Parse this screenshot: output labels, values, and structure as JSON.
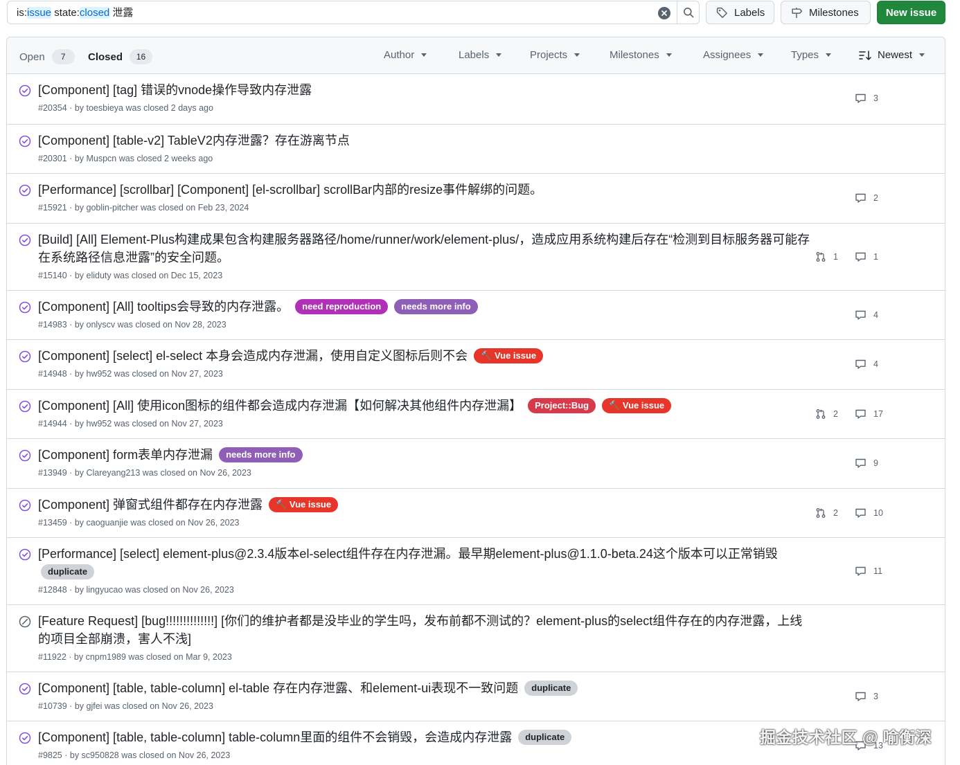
{
  "search": {
    "tokens": [
      {
        "text": "is:",
        "kind": "key"
      },
      {
        "text": "issue",
        "kind": "val"
      },
      {
        "text": " state:",
        "kind": "key"
      },
      {
        "text": "closed",
        "kind": "val"
      },
      {
        "text": " 泄露",
        "kind": "key"
      }
    ]
  },
  "toolbar": {
    "labels_label": "Labels",
    "milestones_label": "Milestones",
    "new_issue_label": "New issue"
  },
  "header": {
    "open_label": "Open",
    "open_count": "7",
    "closed_label": "Closed",
    "closed_count": "16",
    "filters": [
      "Author",
      "Labels",
      "Projects",
      "Milestones",
      "Assignees",
      "Types"
    ],
    "sort_label": "Newest"
  },
  "issues": [
    {
      "title": "[Component] [tag] 错误的vnode操作导致内存泄露",
      "labels": [],
      "meta": "#20354 · by toesbieya was closed 2 days ago",
      "state": "completed",
      "prs": null,
      "comments": "3"
    },
    {
      "title": "[Component] [table-v2] TableV2内存泄露？存在游离节点",
      "labels": [],
      "meta": "#20301 · by Muspcn was closed 2 weeks ago",
      "state": "completed",
      "prs": null,
      "comments": null
    },
    {
      "title": "[Performance] [scrollbar] [Component] [el-scrollbar] scrollBar内部的resize事件解绑的问题。",
      "labels": [],
      "meta": "#15921 · by goblin-pitcher was closed on Feb 23, 2024",
      "state": "completed",
      "prs": null,
      "comments": "2"
    },
    {
      "title": "[Build] [All] Element-Plus构建成果包含构建服务器路径/home/runner/work/element-plus/，造成应用系统构建后存在“检测到目标服务器可能存在系统路径信息泄露”的安全问题。",
      "labels": [],
      "meta": "#15140 · by eliduty was closed on Dec 15, 2023",
      "state": "completed",
      "prs": "1",
      "comments": "1"
    },
    {
      "title": "[Component] [All] tooltips会导致的内存泄露。",
      "labels": [
        {
          "text": "need reproduction",
          "kind": "needrep"
        },
        {
          "text": "needs more info",
          "kind": "moreinfo"
        }
      ],
      "meta": "#14983 · by onlyscv was closed on Nov 28, 2023",
      "state": "completed",
      "prs": null,
      "comments": "4"
    },
    {
      "title": "[Component] [select] el-select 本身会造成内存泄漏，使用自定义图标后则不会",
      "labels": [
        {
          "text": "🔨 Vue issue",
          "kind": "vue"
        }
      ],
      "meta": "#14948 · by hw952 was closed on Nov 27, 2023",
      "state": "completed",
      "prs": null,
      "comments": "4"
    },
    {
      "title": "[Component] [All] 使用icon图标的组件都会造成内存泄漏【如何解决其他组件内存泄漏】",
      "labels": [
        {
          "text": "Project::Bug",
          "kind": "bug"
        },
        {
          "text": "🔨 Vue issue",
          "kind": "vue"
        }
      ],
      "meta": "#14944 · by hw952 was closed on Nov 27, 2023",
      "state": "completed",
      "prs": "2",
      "comments": "17"
    },
    {
      "title": "[Component] form表单内存泄漏",
      "labels": [
        {
          "text": "needs more info",
          "kind": "moreinfo"
        }
      ],
      "meta": "#13949 · by Clareyang213 was closed on Nov 26, 2023",
      "state": "completed",
      "prs": null,
      "comments": "9"
    },
    {
      "title": "[Component] 弹窗式组件都存在内存泄露",
      "labels": [
        {
          "text": "🔨 Vue issue",
          "kind": "vue"
        }
      ],
      "meta": "#13459 · by caoguanjie was closed on Nov 26, 2023",
      "state": "completed",
      "prs": "2",
      "comments": "10"
    },
    {
      "title": "[Performance] [select] element-plus@2.3.4版本el-select组件存在内存泄漏。最早期element-plus@1.1.0-beta.24这个版本可以正常销毁",
      "labels": [
        {
          "text": "duplicate",
          "kind": "dup"
        }
      ],
      "meta": "#12848 · by lingyucao was closed on Nov 26, 2023",
      "state": "completed",
      "prs": null,
      "comments": "11"
    },
    {
      "title": "[Feature Request] [bug!!!!!!!!!!!!!!] [你们的维护者都是没毕业的学生吗，发布前都不测试的？element-plus的select组件存在的内存泄露，上线的项目全部崩溃，害人不浅]",
      "labels": [],
      "meta": "#11922 · by cnpm1989 was closed on Mar 9, 2023",
      "state": "not_planned",
      "prs": null,
      "comments": null
    },
    {
      "title": "[Component] [table, table-column] el-table 存在内存泄露、和element-ui表现不一致问题",
      "labels": [
        {
          "text": "duplicate",
          "kind": "dup"
        }
      ],
      "meta": "#10739 · by gjfei was closed on Nov 26, 2023",
      "state": "completed",
      "prs": null,
      "comments": "3"
    },
    {
      "title": "[Component] [table, table-column] table-column里面的组件不会销毁，会造成内存泄露",
      "labels": [
        {
          "text": "duplicate",
          "kind": "dup"
        }
      ],
      "meta": "#9825 · by sc950828 was closed on Nov 26, 2023",
      "state": "completed",
      "prs": null,
      "comments": "13"
    }
  ],
  "watermark": "掘金技术社区 @ 喻衡深",
  "colors": {
    "accent": "#0969da",
    "primary_button": "#1f883d",
    "closed_icon": "#8250df",
    "not_planned_icon": "#59636e"
  }
}
